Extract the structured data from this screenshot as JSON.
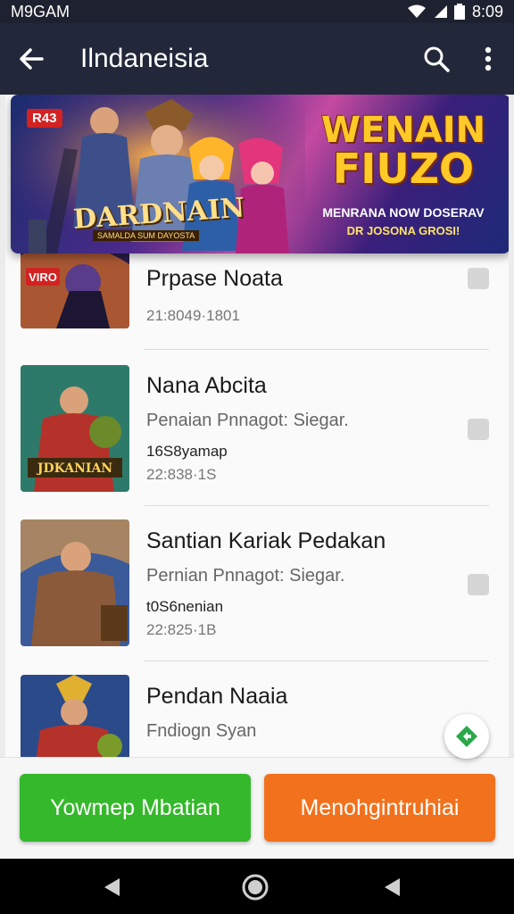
{
  "status": {
    "time_left": "M9GAM",
    "time_right": "8:09"
  },
  "appbar": {
    "title": "Ilndaneisia"
  },
  "banner": {
    "tag": "R43",
    "heading_line1": "WENAIN",
    "heading_line2": "FIUZO",
    "sub_line1": "MENRANA NOW DOSERAV",
    "sub_line2": "DR JOSONA GROSI!",
    "logo": "DARDNAIN",
    "logo_sub": "SAMALDA SUM DAYOSTA"
  },
  "items": [
    {
      "title": "Prpase Noata",
      "subtitle": "",
      "meta": "",
      "time": "21:8049·1801",
      "thumb_tag": "VIRO"
    },
    {
      "title": "Nana Abcita",
      "subtitle": "Penaian Pnnagot: Siegar.",
      "meta": "16S8yamap",
      "time": "22:838·1S",
      "thumb_tag": "JDKANIAN"
    },
    {
      "title": "Santian Kariak Pedakan",
      "subtitle": "Pernian Pnnagot: Siegar.",
      "meta": "t0S6nenian",
      "time": "22:825·1B",
      "thumb_tag": ""
    },
    {
      "title": "Pendan Naaia",
      "subtitle": "Fndiogn Syan",
      "meta": "",
      "time": "",
      "thumb_tag": ""
    }
  ],
  "buttons": {
    "left": "Yowmep Mbatian",
    "right": "Menohgintruhiai"
  },
  "colors": {
    "appbar": "#22283a",
    "green": "#35b82b",
    "orange": "#f2711c"
  }
}
